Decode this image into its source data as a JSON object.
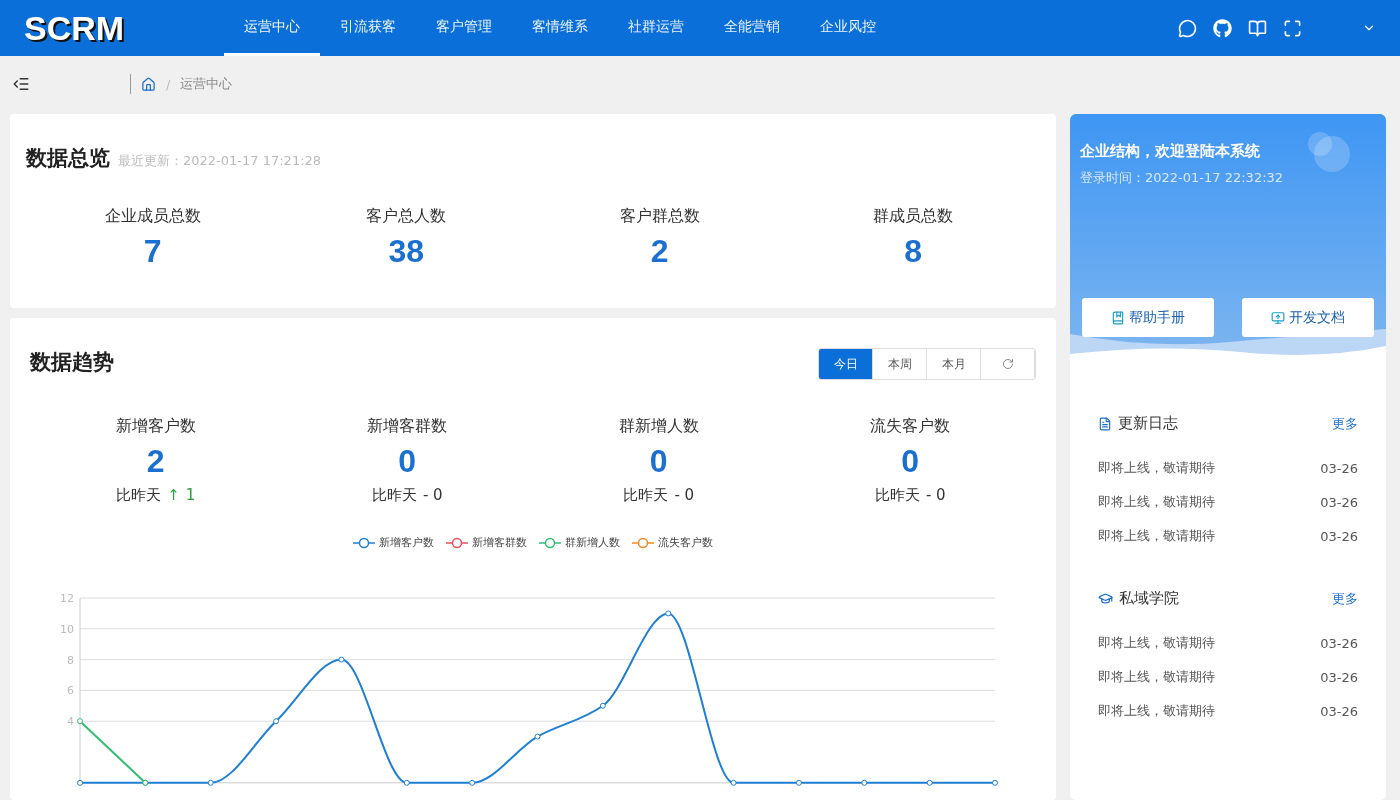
{
  "header": {
    "logo": "SCRM",
    "nav": [
      {
        "label": "运营中心",
        "selected": true
      },
      {
        "label": "引流获客",
        "selected": false
      },
      {
        "label": "客户管理",
        "selected": false
      },
      {
        "label": "客情维系",
        "selected": false
      },
      {
        "label": "社群运营",
        "selected": false
      },
      {
        "label": "全能营销",
        "selected": false
      },
      {
        "label": "企业风控",
        "selected": false
      }
    ]
  },
  "breadcrumb": {
    "separator": "/",
    "current": "运营中心"
  },
  "overview": {
    "title": "数据总览",
    "updated": "最近更新：2022-01-17 17:21:28",
    "stats": [
      {
        "label": "企业成员总数",
        "value": "7"
      },
      {
        "label": "客户总人数",
        "value": "38"
      },
      {
        "label": "客户群总数",
        "value": "2"
      },
      {
        "label": "群成员总数",
        "value": "8"
      }
    ]
  },
  "trend": {
    "title": "数据趋势",
    "ranges": [
      {
        "label": "今日",
        "selected": true
      },
      {
        "label": "本周",
        "selected": false
      },
      {
        "label": "本月",
        "selected": false
      }
    ],
    "stats": [
      {
        "label": "新增客户数",
        "value": "2",
        "compare": "比昨天",
        "kind": "up",
        "arrow": "↑",
        "delta": "1"
      },
      {
        "label": "新增客群数",
        "value": "0",
        "compare": "比昨天",
        "kind": "flat",
        "delta": "- 0"
      },
      {
        "label": "群新增人数",
        "value": "0",
        "compare": "比昨天",
        "kind": "flat",
        "delta": "- 0"
      },
      {
        "label": "流失客户数",
        "value": "0",
        "compare": "比昨天",
        "kind": "flat",
        "delta": "- 0"
      }
    ],
    "chart_data": {
      "type": "line",
      "grid": true,
      "ylim": [
        0,
        12
      ],
      "yticks": [
        4,
        6,
        8,
        10,
        12
      ],
      "series": [
        {
          "name": "新增客户数",
          "color": "#1f7fd4",
          "marker": "circle",
          "values": [
            0,
            0,
            0,
            4,
            8,
            0,
            0,
            3,
            5,
            11,
            0,
            0,
            0,
            0,
            0
          ]
        },
        {
          "name": "新增客群数",
          "color": "#e8505b",
          "values": [
            null,
            null,
            null,
            null,
            null,
            null,
            null,
            null,
            null,
            null,
            null,
            null,
            null,
            null,
            null
          ]
        },
        {
          "name": "群新增人数",
          "color": "#2fbf71",
          "marker": "circle",
          "values": [
            4,
            0,
            null,
            null,
            null,
            null,
            null,
            null,
            null,
            null,
            null,
            null,
            null,
            null,
            null
          ]
        },
        {
          "name": "流失客户数",
          "color": "#f08a24",
          "values": [
            null,
            null,
            null,
            null,
            null,
            null,
            null,
            null,
            null,
            null,
            null,
            null,
            null,
            null,
            null
          ]
        }
      ]
    }
  },
  "welcome": {
    "title": "企业结构，欢迎登陆本系统",
    "login_time": "登录时间：2022-01-17 22:32:32",
    "buttons": [
      {
        "label": "帮助手册",
        "kind": "manual"
      },
      {
        "label": "开发文档",
        "kind": "docs"
      }
    ]
  },
  "sections": [
    {
      "title": "更新日志",
      "kind": "log",
      "more": "更多",
      "items": [
        {
          "text": "即将上线，敬请期待",
          "date": "03-26"
        },
        {
          "text": "即将上线，敬请期待",
          "date": "03-26"
        },
        {
          "text": "即将上线，敬请期待",
          "date": "03-26"
        }
      ]
    },
    {
      "title": "私域学院",
      "kind": "school",
      "more": "更多",
      "items": [
        {
          "text": "即将上线，敬请期待",
          "date": "03-26"
        },
        {
          "text": "即将上线，敬请期待",
          "date": "03-26"
        },
        {
          "text": "即将上线，敬请期待",
          "date": "03-26"
        }
      ]
    }
  ]
}
